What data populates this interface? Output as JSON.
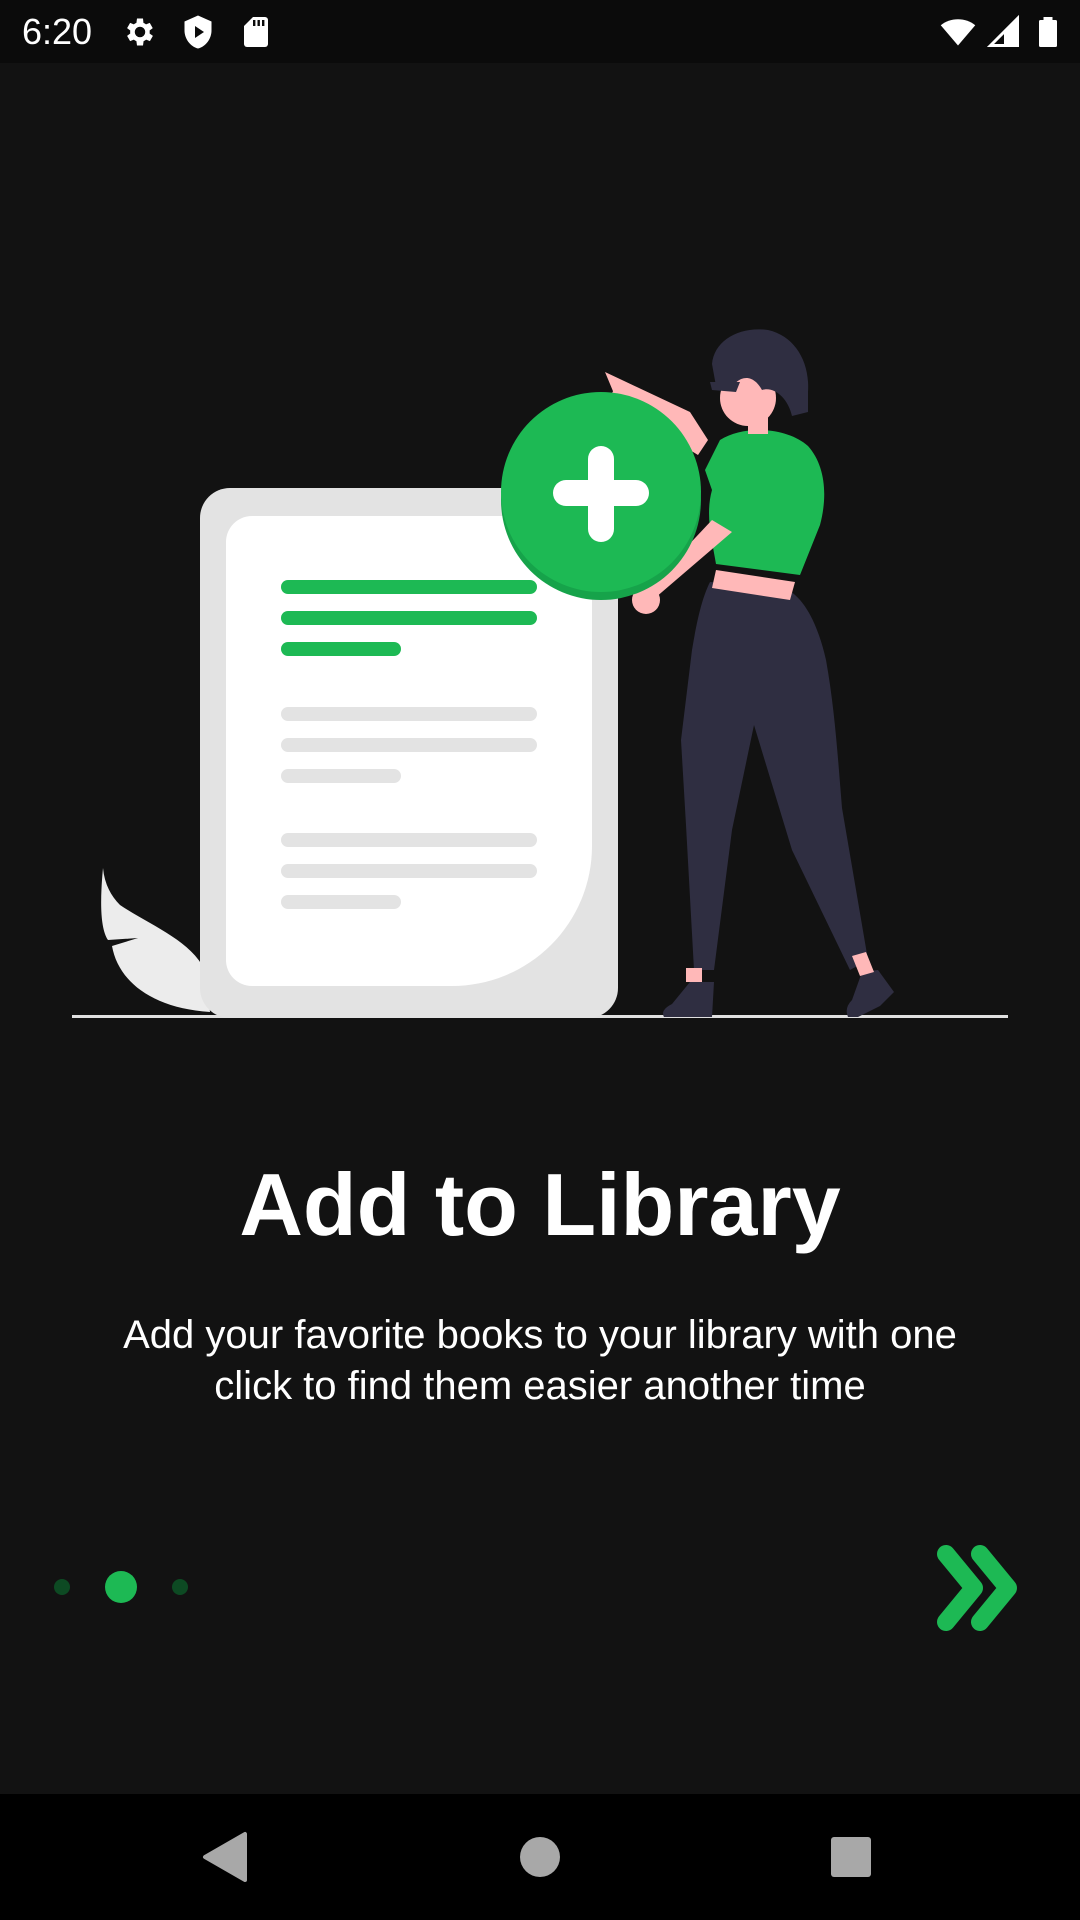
{
  "status_bar": {
    "time": "6:20",
    "left_icons": [
      "gear-icon",
      "shield-play-icon",
      "sd-card-icon"
    ],
    "right_icons": [
      "wifi-icon",
      "signal-icon",
      "battery-icon"
    ]
  },
  "onboarding": {
    "title": "Add to Library",
    "description": "Add your favorite books to your library with one click to find them easier another time",
    "page_indicator": {
      "total": 3,
      "current": 2
    },
    "next_icon": "double-chevron-right-icon"
  },
  "navigation_bar": {
    "buttons": [
      "back-icon",
      "home-icon",
      "recents-icon"
    ]
  },
  "colors": {
    "background": "#121212",
    "accent": "#1db954",
    "accent_dim": "#0d4a23",
    "text": "#ffffff",
    "figure_dark": "#2f2e41",
    "skin": "#ffb8b8"
  }
}
